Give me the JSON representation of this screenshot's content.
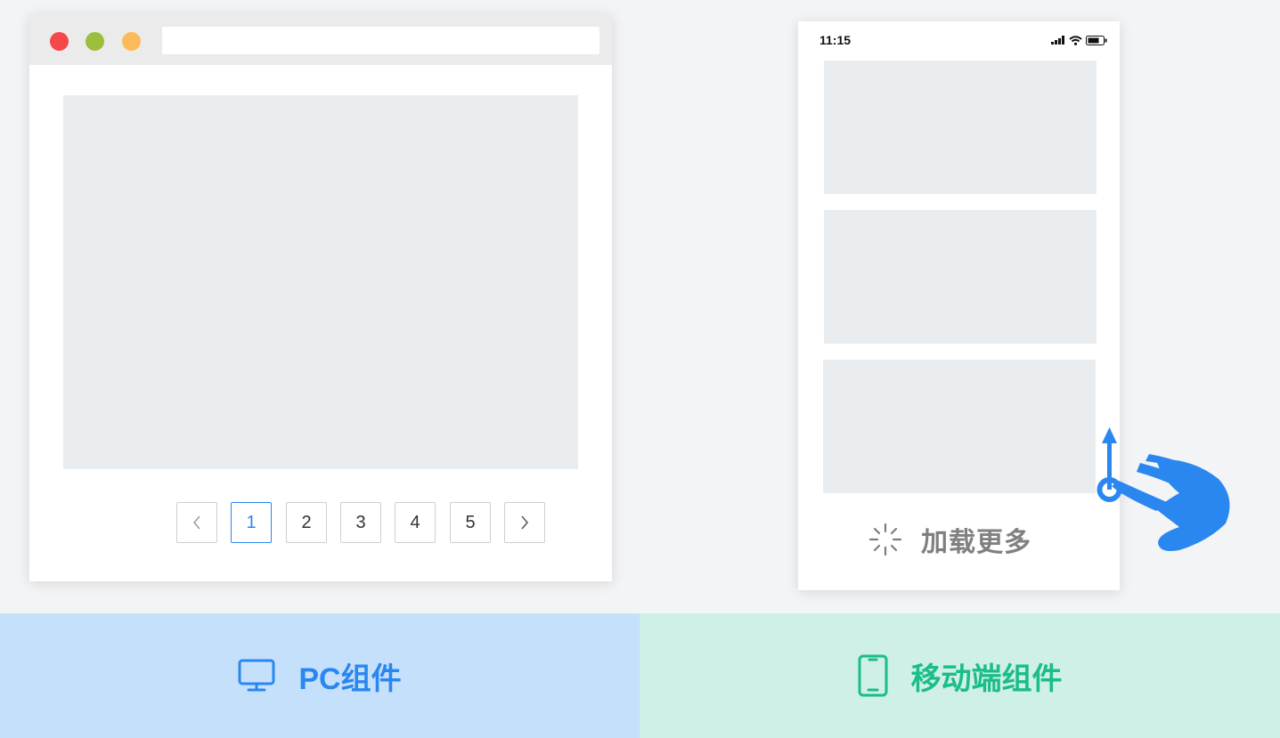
{
  "pc_window": {
    "traffic_lights": [
      "close",
      "minimize",
      "maximize"
    ],
    "pagination": {
      "prev_icon": "chevron-left-icon",
      "next_icon": "chevron-right-icon",
      "pages": [
        "1",
        "2",
        "3",
        "4",
        "5"
      ],
      "active_page": "1"
    }
  },
  "phone": {
    "status_time": "11:15",
    "status_icons": [
      "signal-icon",
      "wifi-icon",
      "battery-icon"
    ],
    "load_more_label": "加载更多",
    "gesture_icon": "swipe-up-hand-icon"
  },
  "bottom_bar": {
    "pc_label": "PC组件",
    "pc_icon": "monitor-icon",
    "mobile_label": "移动端组件",
    "mobile_icon": "phone-icon"
  },
  "colors": {
    "accent_blue": "#2b87f0",
    "accent_green": "#1bbd88",
    "placeholder_gray": "#e9edf0"
  }
}
